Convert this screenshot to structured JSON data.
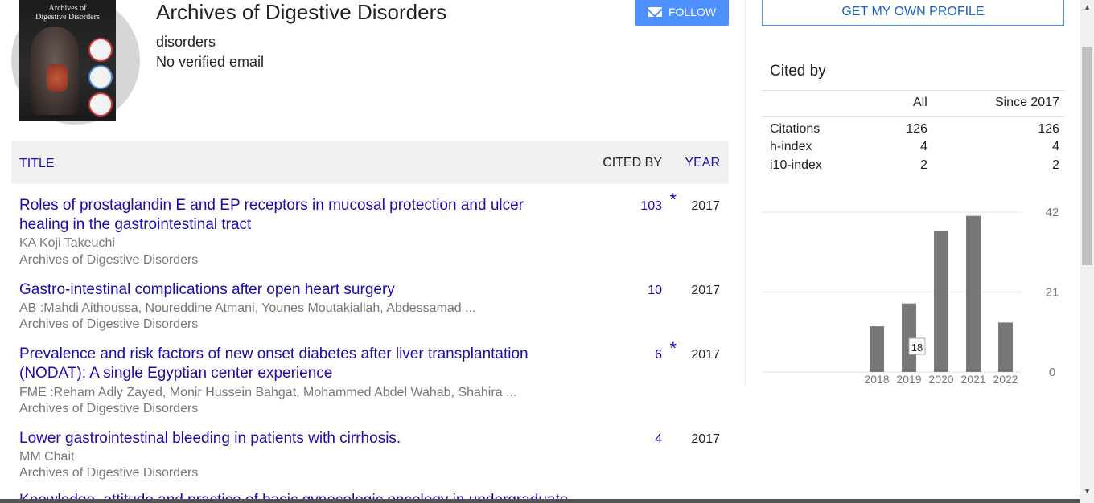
{
  "profile": {
    "cover_title": "Archives of\nDigestive Disorders",
    "name": "Archives of Digestive Disorders",
    "affiliation": "disorders",
    "email": "No verified email",
    "follow_label": "FOLLOW",
    "get_profile_label": "GET MY OWN PROFILE"
  },
  "table": {
    "headers": {
      "title": "TITLE",
      "cited_by": "CITED BY",
      "year": "YEAR"
    },
    "rows": [
      {
        "title": "Roles of prostaglandin E and EP receptors in mucosal protection and ulcer healing in the gastrointestinal tract",
        "authors": "KA Koji Takeuchi",
        "venue": "Archives of Digestive Disorders",
        "cites": "103",
        "star": "*",
        "year": "2017"
      },
      {
        "title": "Gastro-intestinal complications after open heart surgery",
        "authors": "AB :Mahdi Aithoussa, Noureddine Atmani, Younes Moutakiallah, Abdessamad ...",
        "venue": "Archives of Digestive Disorders",
        "cites": "10",
        "star": "",
        "year": "2017"
      },
      {
        "title": "Prevalence and risk factors of new onset diabetes after liver transplantation (NODAT): A single Egyptian center experience",
        "authors": "FME :Reham Adly Zayed, Monir Hussein Bahgat, Mohammed Abdel Wahab, Shahira ...",
        "venue": "Archives of Digestive Disorders",
        "cites": "6",
        "star": "*",
        "year": "2017"
      },
      {
        "title": "Lower gastrointestinal bleeding in patients with cirrhosis.",
        "authors": "MM Chait",
        "venue": "Archives of Digestive Disorders",
        "cites": "4",
        "star": "",
        "year": "2017"
      }
    ],
    "cut_row_title": "Knowledge, attitude and practice of basic gynecologic oncology in undergraduate"
  },
  "cited_by": {
    "title": "Cited by",
    "col_all": "All",
    "col_since": "Since 2017",
    "stats": [
      {
        "label": "Citations",
        "all": "126",
        "since": "126"
      },
      {
        "label": "h-index",
        "all": "4",
        "since": "4"
      },
      {
        "label": "i10-index",
        "all": "2",
        "since": "2"
      }
    ]
  },
  "chart_data": {
    "type": "bar",
    "categories": [
      "2018",
      "2019",
      "2020",
      "2021",
      "2022"
    ],
    "values": [
      12,
      18,
      37,
      41,
      13
    ],
    "ylim": [
      0,
      42
    ],
    "yticks": [
      "0",
      "21",
      "42"
    ],
    "tooltip": "18",
    "bar_color": "#777777",
    "grid": true
  },
  "colors": {
    "link": "#1a0dab",
    "accent": "#4d90fe"
  }
}
